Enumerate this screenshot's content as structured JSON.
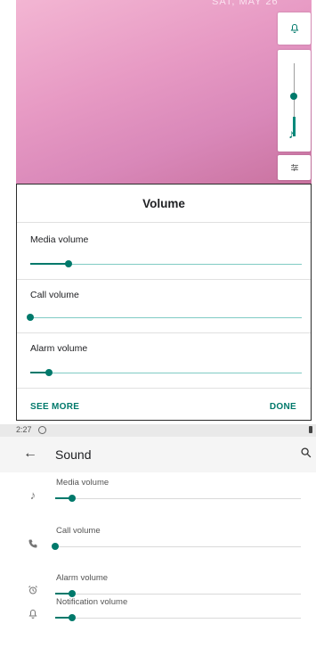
{
  "lockscreen": {
    "date_text": "SAT, MAY 26"
  },
  "volume_rail": {
    "ringer_icon": "bell-icon",
    "music_icon": "music-note-icon",
    "settings_icon": "equalizer-icon",
    "level": 0.38
  },
  "dialog": {
    "title": "Volume",
    "sliders": [
      {
        "label": "Media volume",
        "value": 0.14
      },
      {
        "label": "Call volume",
        "value": 0.0
      },
      {
        "label": "Alarm volume",
        "value": 0.07
      }
    ],
    "see_more_label": "SEE MORE",
    "done_label": "DONE"
  },
  "status_bar": {
    "time": "2:27"
  },
  "sound_screen": {
    "title": "Sound",
    "back_icon": "arrow-back-icon",
    "search_icon": "search-icon",
    "rows": [
      {
        "label": "Media volume",
        "icon": "music-note-icon",
        "value": 0.07
      },
      {
        "label": "Call volume",
        "icon": "phone-icon",
        "value": 0.0
      },
      {
        "label": "Alarm volume",
        "icon": "alarm-clock-icon",
        "value": 0.07
      },
      {
        "label": "Notification volume",
        "icon": "bell-icon",
        "value": 0.07
      }
    ]
  },
  "colors": {
    "accent": "#00796b",
    "track": "#80cbc4"
  }
}
